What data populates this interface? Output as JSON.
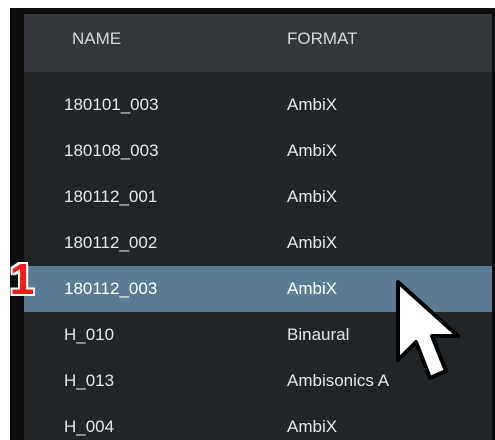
{
  "header": {
    "name_label": "NAME",
    "format_label": "FORMAT"
  },
  "rows": [
    {
      "name": "180101_003",
      "format": "AmbiX"
    },
    {
      "name": "180108_003",
      "format": "AmbiX"
    },
    {
      "name": "180112_001",
      "format": "AmbiX"
    },
    {
      "name": "180112_002",
      "format": "AmbiX"
    },
    {
      "name": "180112_003",
      "format": "AmbiX"
    },
    {
      "name": "H_010",
      "format": "Binaural"
    },
    {
      "name": "H_013",
      "format": "Ambisonics A"
    },
    {
      "name": "H_004",
      "format": "AmbiX"
    }
  ],
  "selected_row": 4,
  "step_marker": "1",
  "colors": {
    "selected_row": "#5b7c93",
    "scrollbar": "#2f95d8",
    "marker": "#ff1a1a"
  },
  "icons": {
    "cursor": "arrow-cursor-icon"
  }
}
